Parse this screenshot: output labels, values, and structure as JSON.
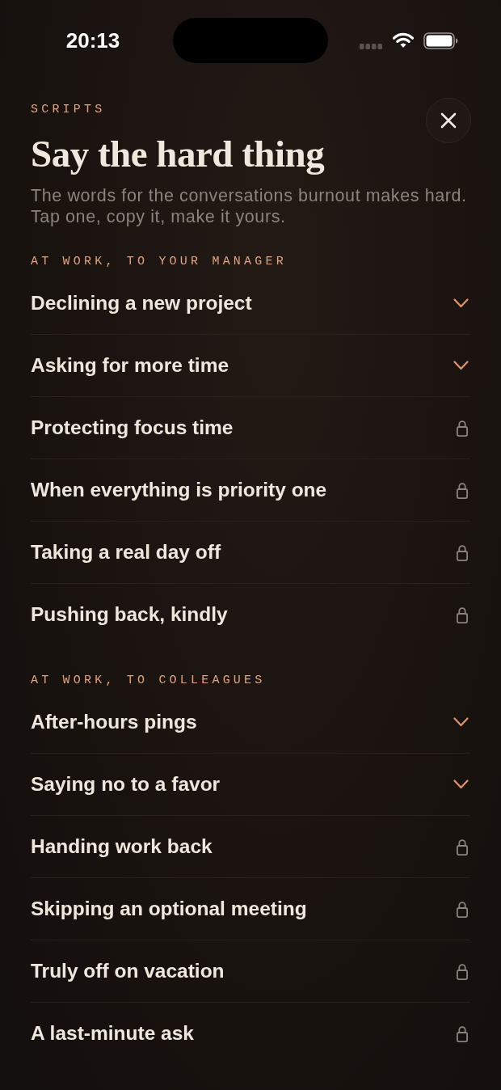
{
  "status_bar": {
    "time": "20:13"
  },
  "header": {
    "eyebrow": "SCRIPTS",
    "title": "Say the hard thing",
    "subtitle": "The words for the conversations burnout makes hard. Tap one, copy it, make it yours."
  },
  "sections": [
    {
      "heading": "AT WORK, TO YOUR MANAGER",
      "items": [
        {
          "label": "Declining a new project",
          "locked": false
        },
        {
          "label": "Asking for more time",
          "locked": false
        },
        {
          "label": "Protecting focus time",
          "locked": true
        },
        {
          "label": "When everything is priority one",
          "locked": true
        },
        {
          "label": "Taking a real day off",
          "locked": true
        },
        {
          "label": "Pushing back, kindly",
          "locked": true
        }
      ]
    },
    {
      "heading": "AT WORK, TO COLLEAGUES",
      "items": [
        {
          "label": "After-hours pings",
          "locked": false
        },
        {
          "label": "Saying no to a favor",
          "locked": false
        },
        {
          "label": "Handing work back",
          "locked": true
        },
        {
          "label": "Skipping an optional meeting",
          "locked": true
        },
        {
          "label": "Truly off on vacation",
          "locked": true
        },
        {
          "label": "A last-minute ask",
          "locked": true
        }
      ]
    }
  ]
}
